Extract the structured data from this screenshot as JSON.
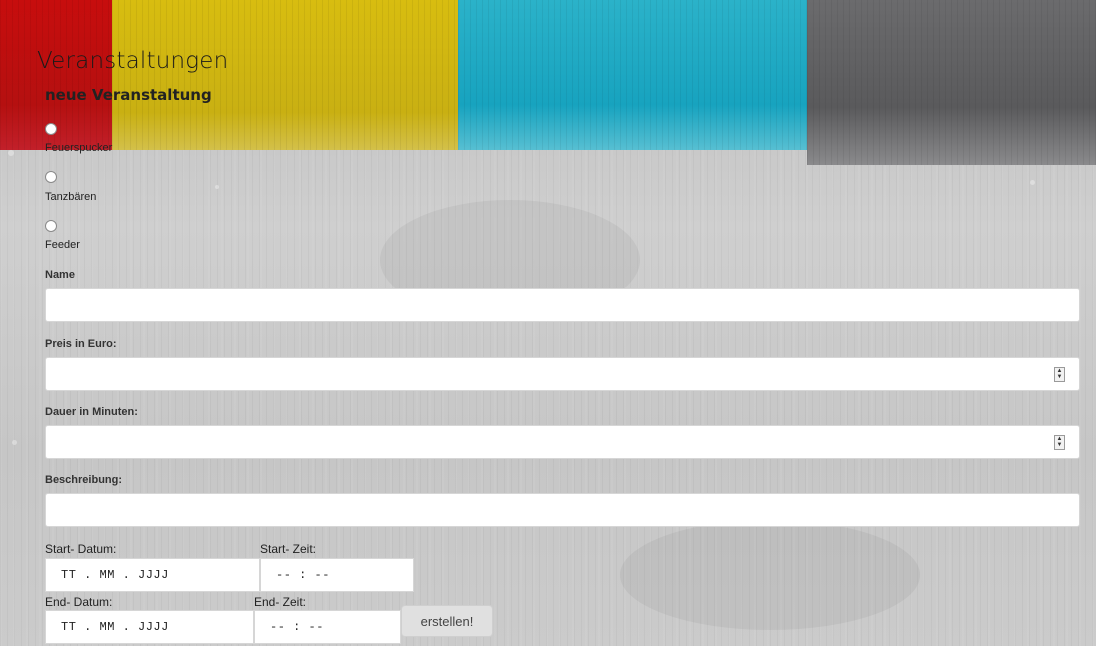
{
  "page": {
    "title": "Veranstaltungen",
    "section_title": "neue Veranstaltung"
  },
  "event_types": [
    {
      "label": "Feuerspucker",
      "selected": false
    },
    {
      "label": "Tanzbären",
      "selected": false
    },
    {
      "label": "Feeder",
      "selected": false
    }
  ],
  "fields": {
    "name": {
      "label": "Name",
      "value": ""
    },
    "price": {
      "label": "Preis in Euro:",
      "value": ""
    },
    "duration": {
      "label": "Dauer in Minuten:",
      "value": ""
    },
    "description": {
      "label": "Beschreibung:",
      "value": ""
    },
    "start_date": {
      "label": "Start- Datum:",
      "placeholder": "TT . MM . JJJJ"
    },
    "start_time": {
      "label": "Start- Zeit:",
      "placeholder": "-- : --"
    },
    "end_date": {
      "label": "End- Datum:",
      "placeholder": "TT . MM . JJJJ"
    },
    "end_time": {
      "label": "End- Zeit:",
      "placeholder": "-- : --"
    }
  },
  "actions": {
    "submit_label": "erstellen!"
  },
  "colors": {
    "banner_red": "#c70d0d",
    "banner_yellow": "#d8bd10",
    "banner_cyan": "#2bb2c9",
    "banner_gray": "#5f5f61",
    "background": "#c9c9c9"
  },
  "icons": {
    "spinner": "spin-up-down-icon"
  }
}
